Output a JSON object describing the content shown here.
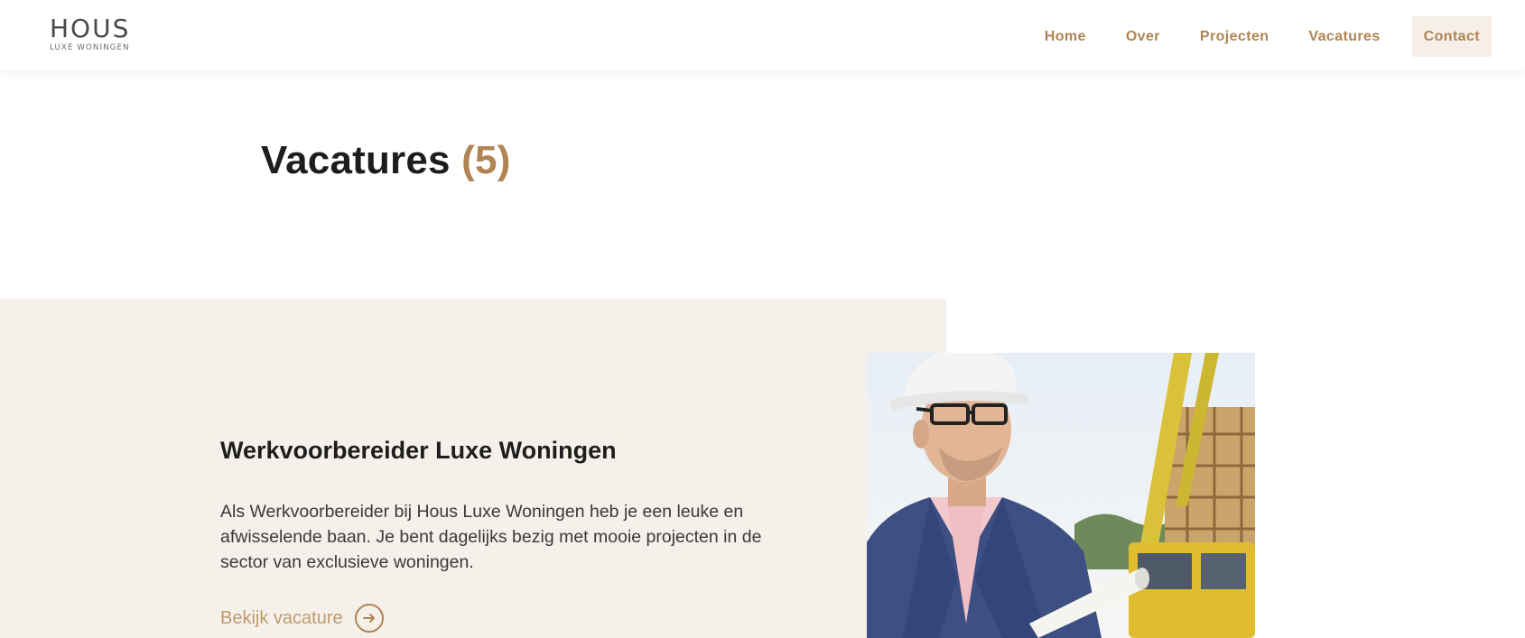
{
  "header": {
    "logo_main": "HOUS",
    "logo_sub": "LUXE WONINGEN",
    "nav": [
      {
        "label": "Home"
      },
      {
        "label": "Over"
      },
      {
        "label": "Projecten"
      },
      {
        "label": "Vacatures"
      },
      {
        "label": "Contact"
      }
    ]
  },
  "page": {
    "title": "Vacatures",
    "count": "(5)"
  },
  "vacancy": {
    "title": "Werkvoorbereider Luxe Woningen",
    "description": "Als Werkvoorbereider bij Hous Luxe Woningen heb je een leuke en afwisselende baan. Je bent dagelijks bezig met mooie projecten in de sector van exclusieve woningen.",
    "link_label": "Bekijk vacature",
    "link_icon": "arrow-right-circle-icon"
  },
  "colors": {
    "accent": "#b08453",
    "band_background": "#f5f0ea",
    "contact_background": "#f5efe8",
    "heading": "#1d1d1d"
  }
}
